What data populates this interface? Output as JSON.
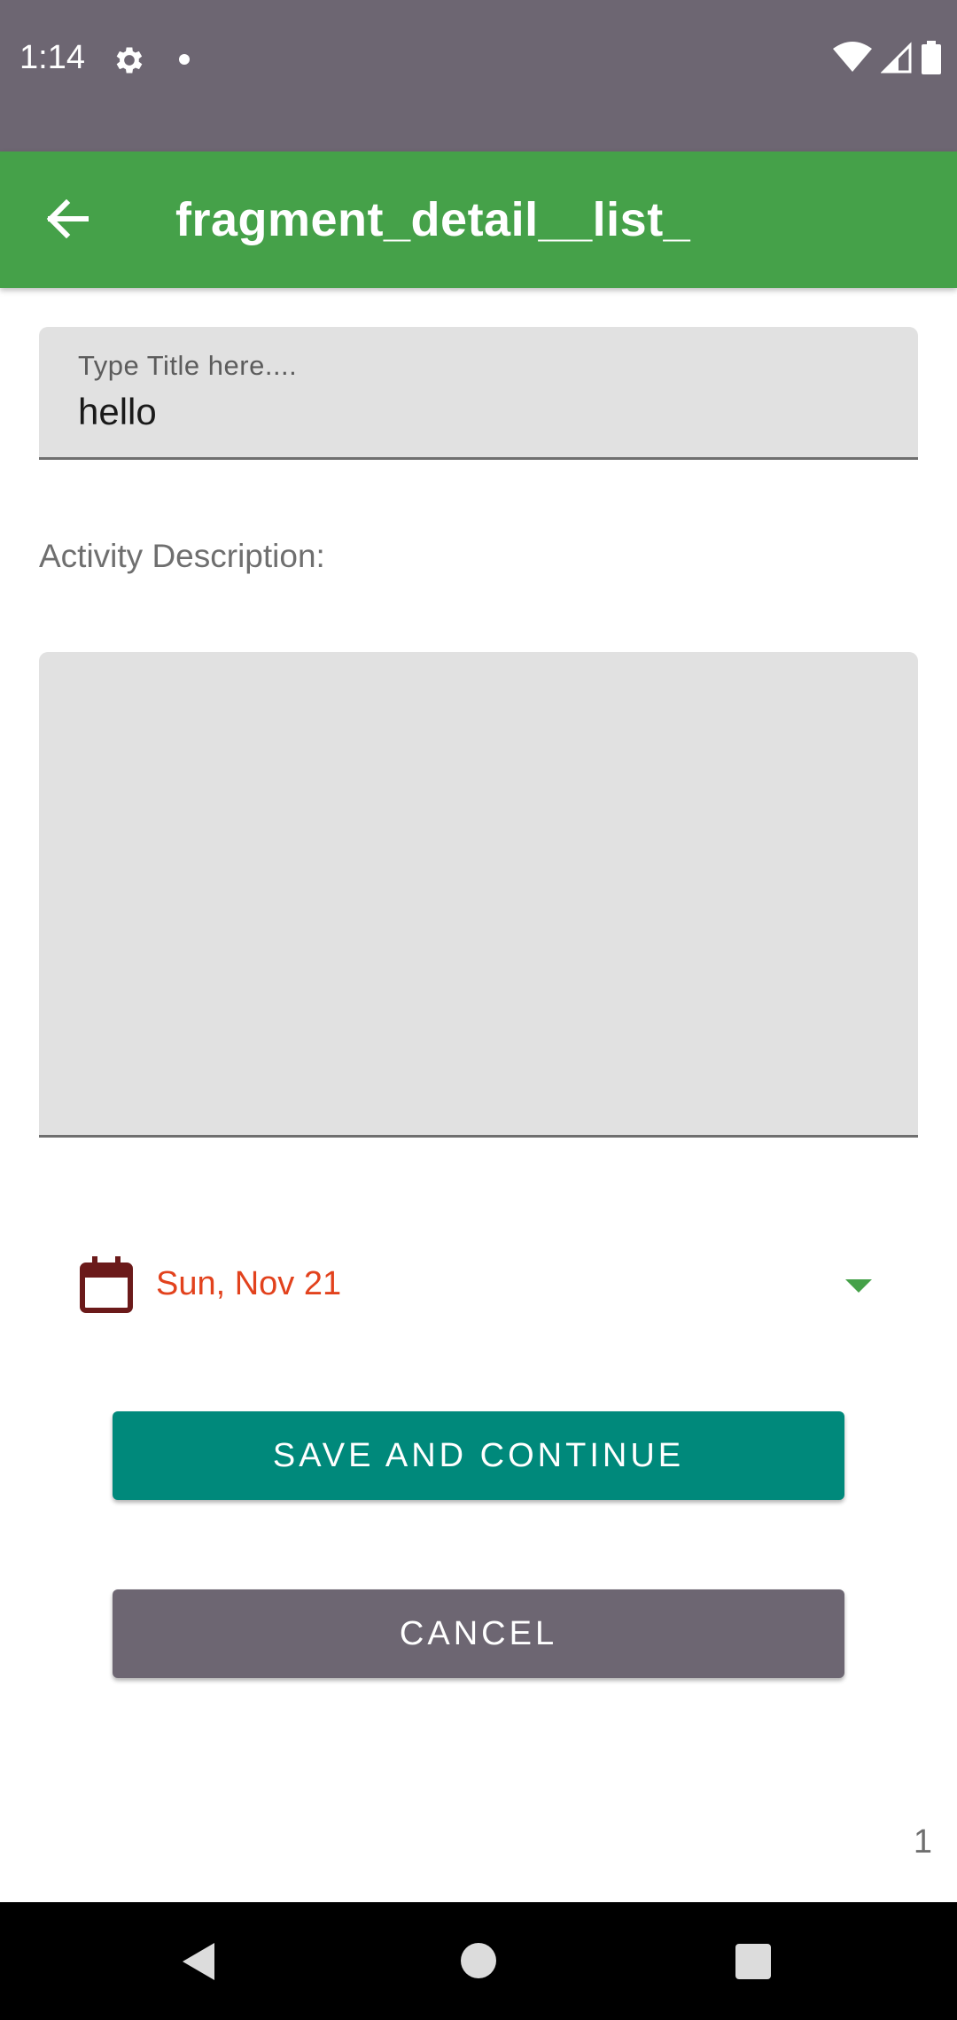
{
  "status_bar": {
    "time": "1:14",
    "icons": [
      "gear-icon",
      "notification-dot-icon",
      "wifi-icon",
      "signal-icon",
      "battery-icon"
    ]
  },
  "app_bar": {
    "title": "fragment_detail__list_",
    "back_icon": "arrow-left-icon",
    "color": "#45a149"
  },
  "form": {
    "title_field": {
      "placeholder": "Type Title here....",
      "value": "hello"
    },
    "description_label": "Activity Description:",
    "description_value": "",
    "date": {
      "value": "Sun, Nov 21",
      "icon": "calendar-icon",
      "color": "#e2421d"
    }
  },
  "buttons": {
    "save_label": "SAVE AND CONTINUE",
    "save_color": "#00897b",
    "cancel_label": "CANCEL",
    "cancel_color": "#6d6672"
  },
  "page_number": "1",
  "nav_bar": {
    "icons": [
      "back-triangle-icon",
      "home-circle-icon",
      "recents-square-icon"
    ]
  }
}
